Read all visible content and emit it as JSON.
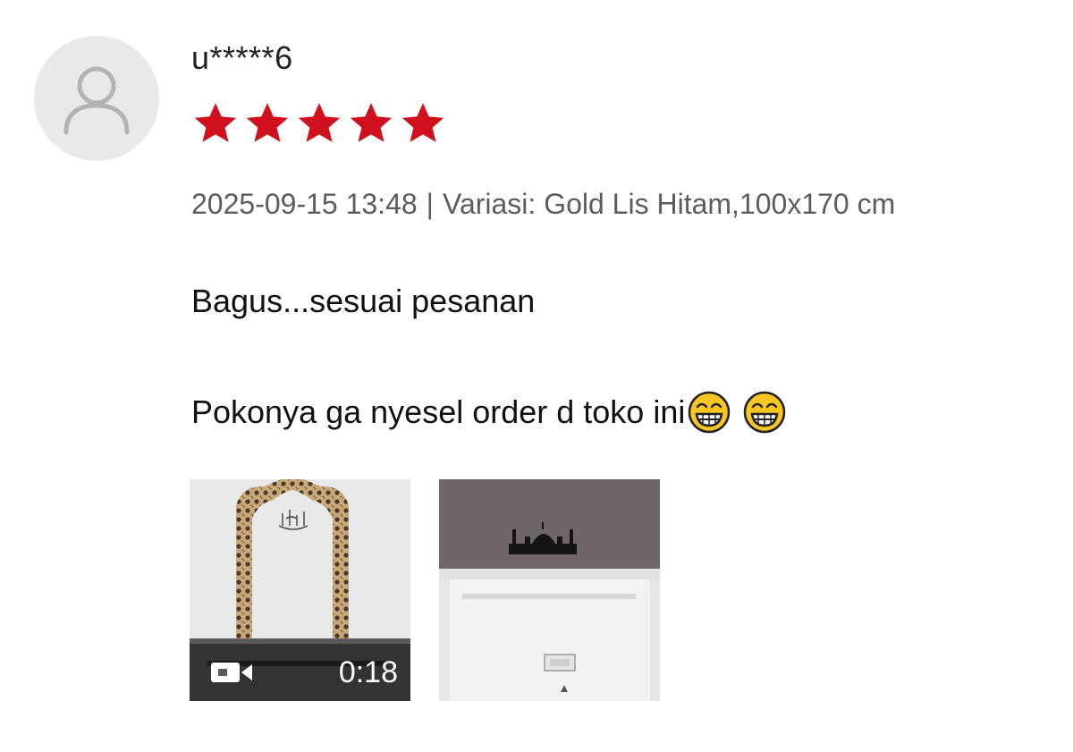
{
  "review": {
    "username": "u*****6",
    "rating": 5,
    "rating_max": 5,
    "date": "2025-09-15 13:48",
    "separator": "|",
    "variation": "Variasi: Gold Lis Hitam,100x170 cm",
    "text_line1": "Bagus...sesuai pesanan",
    "text_line2": "Pokonya ga nyesel order d toko ini",
    "emojis": [
      "grinning-face-with-smiling-eyes",
      "grinning-face-with-smiling-eyes"
    ]
  },
  "media": [
    {
      "type": "video",
      "duration": "0:18",
      "icon": "video-camera-icon"
    },
    {
      "type": "image"
    }
  ],
  "colors": {
    "star": "#d0101c",
    "avatar_bg": "#e9e9e9",
    "meta_text": "#5c5c5c"
  }
}
